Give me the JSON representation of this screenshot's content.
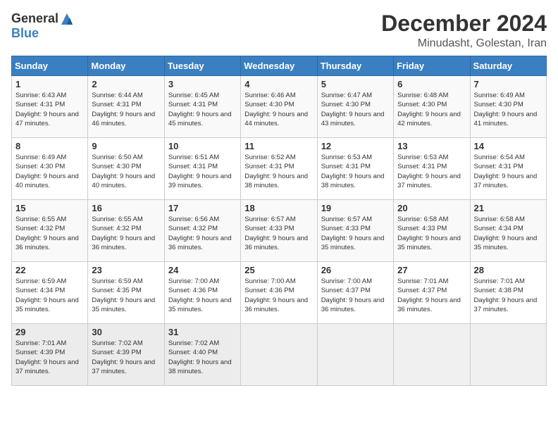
{
  "header": {
    "logo_general": "General",
    "logo_blue": "Blue",
    "month_title": "December 2024",
    "location": "Minudasht, Golestan, Iran"
  },
  "days_of_week": [
    "Sunday",
    "Monday",
    "Tuesday",
    "Wednesday",
    "Thursday",
    "Friday",
    "Saturday"
  ],
  "weeks": [
    [
      {
        "day": "1",
        "sunrise": "6:43 AM",
        "sunset": "4:31 PM",
        "daylight": "9 hours and 47 minutes."
      },
      {
        "day": "2",
        "sunrise": "6:44 AM",
        "sunset": "4:31 PM",
        "daylight": "9 hours and 46 minutes."
      },
      {
        "day": "3",
        "sunrise": "6:45 AM",
        "sunset": "4:31 PM",
        "daylight": "9 hours and 45 minutes."
      },
      {
        "day": "4",
        "sunrise": "6:46 AM",
        "sunset": "4:30 PM",
        "daylight": "9 hours and 44 minutes."
      },
      {
        "day": "5",
        "sunrise": "6:47 AM",
        "sunset": "4:30 PM",
        "daylight": "9 hours and 43 minutes."
      },
      {
        "day": "6",
        "sunrise": "6:48 AM",
        "sunset": "4:30 PM",
        "daylight": "9 hours and 42 minutes."
      },
      {
        "day": "7",
        "sunrise": "6:49 AM",
        "sunset": "4:30 PM",
        "daylight": "9 hours and 41 minutes."
      }
    ],
    [
      {
        "day": "8",
        "sunrise": "6:49 AM",
        "sunset": "4:30 PM",
        "daylight": "9 hours and 40 minutes."
      },
      {
        "day": "9",
        "sunrise": "6:50 AM",
        "sunset": "4:30 PM",
        "daylight": "9 hours and 40 minutes."
      },
      {
        "day": "10",
        "sunrise": "6:51 AM",
        "sunset": "4:31 PM",
        "daylight": "9 hours and 39 minutes."
      },
      {
        "day": "11",
        "sunrise": "6:52 AM",
        "sunset": "4:31 PM",
        "daylight": "9 hours and 38 minutes."
      },
      {
        "day": "12",
        "sunrise": "6:53 AM",
        "sunset": "4:31 PM",
        "daylight": "9 hours and 38 minutes."
      },
      {
        "day": "13",
        "sunrise": "6:53 AM",
        "sunset": "4:31 PM",
        "daylight": "9 hours and 37 minutes."
      },
      {
        "day": "14",
        "sunrise": "6:54 AM",
        "sunset": "4:31 PM",
        "daylight": "9 hours and 37 minutes."
      }
    ],
    [
      {
        "day": "15",
        "sunrise": "6:55 AM",
        "sunset": "4:32 PM",
        "daylight": "9 hours and 36 minutes."
      },
      {
        "day": "16",
        "sunrise": "6:55 AM",
        "sunset": "4:32 PM",
        "daylight": "9 hours and 36 minutes."
      },
      {
        "day": "17",
        "sunrise": "6:56 AM",
        "sunset": "4:32 PM",
        "daylight": "9 hours and 36 minutes."
      },
      {
        "day": "18",
        "sunrise": "6:57 AM",
        "sunset": "4:33 PM",
        "daylight": "9 hours and 36 minutes."
      },
      {
        "day": "19",
        "sunrise": "6:57 AM",
        "sunset": "4:33 PM",
        "daylight": "9 hours and 35 minutes."
      },
      {
        "day": "20",
        "sunrise": "6:58 AM",
        "sunset": "4:33 PM",
        "daylight": "9 hours and 35 minutes."
      },
      {
        "day": "21",
        "sunrise": "6:58 AM",
        "sunset": "4:34 PM",
        "daylight": "9 hours and 35 minutes."
      }
    ],
    [
      {
        "day": "22",
        "sunrise": "6:59 AM",
        "sunset": "4:34 PM",
        "daylight": "9 hours and 35 minutes."
      },
      {
        "day": "23",
        "sunrise": "6:59 AM",
        "sunset": "4:35 PM",
        "daylight": "9 hours and 35 minutes."
      },
      {
        "day": "24",
        "sunrise": "7:00 AM",
        "sunset": "4:36 PM",
        "daylight": "9 hours and 35 minutes."
      },
      {
        "day": "25",
        "sunrise": "7:00 AM",
        "sunset": "4:36 PM",
        "daylight": "9 hours and 36 minutes."
      },
      {
        "day": "26",
        "sunrise": "7:00 AM",
        "sunset": "4:37 PM",
        "daylight": "9 hours and 36 minutes."
      },
      {
        "day": "27",
        "sunrise": "7:01 AM",
        "sunset": "4:37 PM",
        "daylight": "9 hours and 36 minutes."
      },
      {
        "day": "28",
        "sunrise": "7:01 AM",
        "sunset": "4:38 PM",
        "daylight": "9 hours and 37 minutes."
      }
    ],
    [
      {
        "day": "29",
        "sunrise": "7:01 AM",
        "sunset": "4:39 PM",
        "daylight": "9 hours and 37 minutes."
      },
      {
        "day": "30",
        "sunrise": "7:02 AM",
        "sunset": "4:39 PM",
        "daylight": "9 hours and 37 minutes."
      },
      {
        "day": "31",
        "sunrise": "7:02 AM",
        "sunset": "4:40 PM",
        "daylight": "9 hours and 38 minutes."
      },
      null,
      null,
      null,
      null
    ]
  ]
}
